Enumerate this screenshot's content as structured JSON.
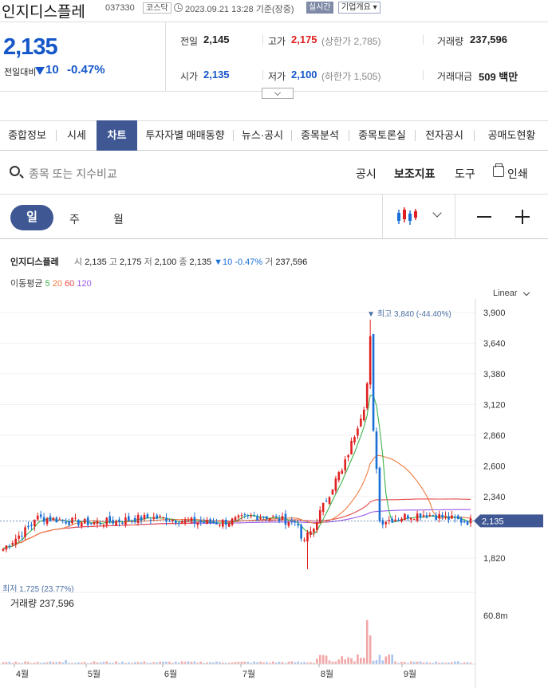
{
  "header": {
    "name": "인지디스플레",
    "code": "037330",
    "market": "코스닥",
    "timestamp": "2023.09.21 13:28",
    "basis": "기준(장중)",
    "realtime": "실시간",
    "company_btn": "기업개요 ▾"
  },
  "price": {
    "current": "2,135",
    "change_label": "전일대비",
    "change": "10",
    "change_pct": "-0.47%"
  },
  "summary": {
    "prev_label": "전일",
    "prev": "2,145",
    "high_label": "고가",
    "high": "2,175",
    "upper_limit": "(상한가 2,785)",
    "volume_label": "거래량",
    "volume": "237,596",
    "open_label": "시가",
    "open": "2,135",
    "low_label": "저가",
    "low": "2,100",
    "lower_limit": "(하한가 1,505)",
    "amount_label": "거래대금",
    "amount": "509 백만"
  },
  "tabs": [
    "종합정보",
    "시세",
    "차트",
    "투자자별 매매동향",
    "뉴스·공시",
    "종목분석",
    "종목토론실",
    "전자공시",
    "공매도현황"
  ],
  "active_tab": "차트",
  "toolbar": {
    "search_placeholder": "종목 또는 지수비교",
    "disclosure": "공시",
    "indicator": "보조지표",
    "tools": "도구",
    "print": "인쇄"
  },
  "periods": {
    "day": "일",
    "week": "주",
    "month": "월"
  },
  "legend": {
    "name": "인지디스플레",
    "open_label": "시",
    "open": "2,135",
    "high_label": "고",
    "high": "2,175",
    "low_label": "저",
    "low": "2,100",
    "close_label": "종",
    "close": "2,135",
    "change": "▼10 -0.47%",
    "vol_label": "거",
    "vol": "237,596",
    "ma_label": "이동평균",
    "ma": [
      "5",
      "20",
      "60",
      "120"
    ],
    "ma_colors": [
      "#3cb44b",
      "#f07a3c",
      "#e84a4a",
      "#9b59e8"
    ]
  },
  "scale_mode": "Linear",
  "chart_data": {
    "type": "candlestick",
    "y_ticks": [
      "3,900",
      "3,640",
      "3,380",
      "3,120",
      "2,860",
      "2,600",
      "2,340",
      "2,135",
      "1,820"
    ],
    "ylim": [
      1820,
      3900
    ],
    "x_ticks": [
      "4월",
      "5월",
      "6월",
      "7월",
      "8월",
      "9월"
    ],
    "current_price_label": "2,135",
    "max_annotation": "▼ 최고 3,840 (-44.40%)",
    "min_annotation": "최저 1,725 (23.77%)",
    "volume_title": "거래량 237,596",
    "volume_axis_label": "60.8m",
    "up_color": "#e02020",
    "down_color": "#1a6fd6"
  }
}
